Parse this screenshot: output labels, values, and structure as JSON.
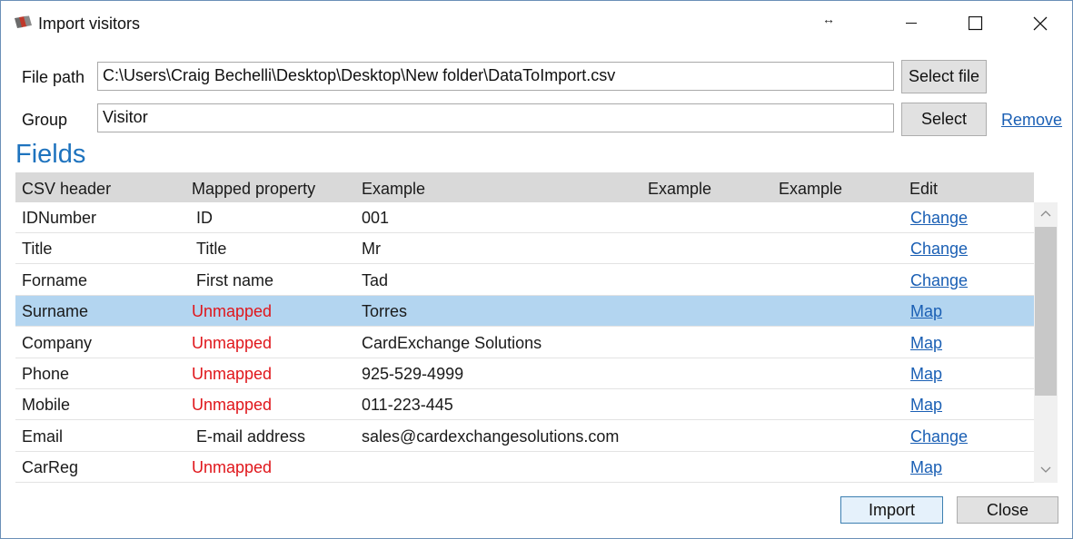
{
  "window": {
    "title": "Import visitors",
    "resize_icon": "horizontal-resize-icon",
    "controls": [
      "minimize-icon",
      "maximize-icon",
      "close-icon"
    ]
  },
  "form": {
    "file_path_label": "File path",
    "file_path_value": "C:\\Users\\Craig Bechelli\\Desktop\\Desktop\\New folder\\DataToImport.csv",
    "select_file_label": "Select file",
    "group_label": "Group",
    "group_value": "Visitor",
    "select_label": "Select",
    "remove_label": "Remove"
  },
  "fields": {
    "heading": "Fields",
    "columns": [
      "CSV header",
      "Mapped property",
      "Example",
      "Example",
      "Example",
      "Edit"
    ],
    "rows": [
      {
        "csv": "IDNumber",
        "mapped": "ID",
        "example": "001",
        "action": "Change",
        "unmapped": false
      },
      {
        "csv": "Title",
        "mapped": "Title",
        "example": "Mr",
        "action": "Change",
        "unmapped": false
      },
      {
        "csv": "Forname",
        "mapped": "First name",
        "example": "Tad",
        "action": "Change",
        "unmapped": false
      },
      {
        "csv": "Surname",
        "mapped": "Unmapped",
        "example": "Torres",
        "action": "Map",
        "unmapped": true,
        "selected": true
      },
      {
        "csv": "Company",
        "mapped": "Unmapped",
        "example": "CardExchange Solutions",
        "action": "Map",
        "unmapped": true
      },
      {
        "csv": "Phone",
        "mapped": "Unmapped",
        "example": "925-529-4999",
        "action": "Map",
        "unmapped": true
      },
      {
        "csv": "Mobile",
        "mapped": "Unmapped",
        "example": "011-223-445",
        "action": "Map",
        "unmapped": true
      },
      {
        "csv": "Email",
        "mapped": "E-mail address",
        "example": "sales@cardexchangesolutions.com",
        "action": "Change",
        "unmapped": false
      },
      {
        "csv": "CarReg",
        "mapped": "Unmapped",
        "example": "",
        "action": "Map",
        "unmapped": true
      }
    ]
  },
  "footer": {
    "import_label": "Import",
    "close_label": "Close"
  },
  "colors": {
    "accent": "#1e73be",
    "unmapped": "#e0161b",
    "selected_row": "#b3d5f0",
    "link": "#1a5fb4"
  }
}
